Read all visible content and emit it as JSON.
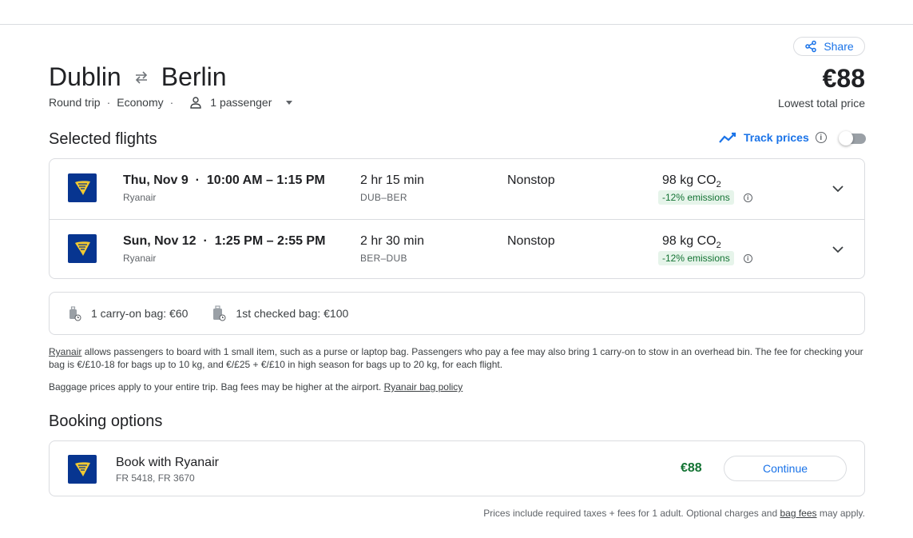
{
  "header": {
    "share_label": "Share",
    "origin": "Dublin",
    "destination": "Berlin",
    "trip_type": "Round trip",
    "cabin": "Economy",
    "passengers": "1 passenger",
    "price": "€88",
    "price_caption": "Lowest total price"
  },
  "selected_flights": {
    "title": "Selected flights",
    "track_prices_label": "Track prices",
    "track_prices_on": false,
    "flights": [
      {
        "date": "Thu, Nov 9",
        "times": "10:00 AM – 1:15 PM",
        "airline": "Ryanair",
        "duration": "2 hr 15 min",
        "route": "DUB–BER",
        "stops": "Nonstop",
        "co2_value": "98 kg CO",
        "co2_sub": "2",
        "emissions": "-12% emissions"
      },
      {
        "date": "Sun, Nov 12",
        "times": "1:25 PM – 2:55 PM",
        "airline": "Ryanair",
        "duration": "2 hr 30 min",
        "route": "BER–DUB",
        "stops": "Nonstop",
        "co2_value": "98 kg CO",
        "co2_sub": "2",
        "emissions": "-12% emissions"
      }
    ]
  },
  "bags": {
    "carry_on": "1 carry-on bag: €60",
    "checked": "1st checked bag: €100"
  },
  "baggage_note": {
    "airline_link": "Ryanair",
    "text": " allows passengers to board with 1 small item, such as a purse or laptop bag. Passengers who pay a fee may also bring 1 carry-on to stow in an overhead bin. The fee for checking your bag is €/£10-18 for bags up to 10 kg, and €/£25 + €/£10 in high season for bags up to 20 kg, for each flight.",
    "line2": "Baggage prices apply to your entire trip. Bag fees may be higher at the airport. ",
    "policy_link": "Ryanair bag policy"
  },
  "booking": {
    "title": "Booking options",
    "provider": "Book with Ryanair",
    "flight_numbers": "FR 5418, FR 3670",
    "price": "€88",
    "continue_label": "Continue"
  },
  "footer": {
    "text": "Prices include required taxes + fees for 1 adult. Optional charges and ",
    "link": "bag fees",
    "suffix": " may apply."
  },
  "colors": {
    "accent": "#1a73e8",
    "ryanair_blue": "#073590",
    "ryanair_gold": "#f1c933",
    "emissions_green": "#137333",
    "emissions_bg": "#e6f4ea"
  }
}
